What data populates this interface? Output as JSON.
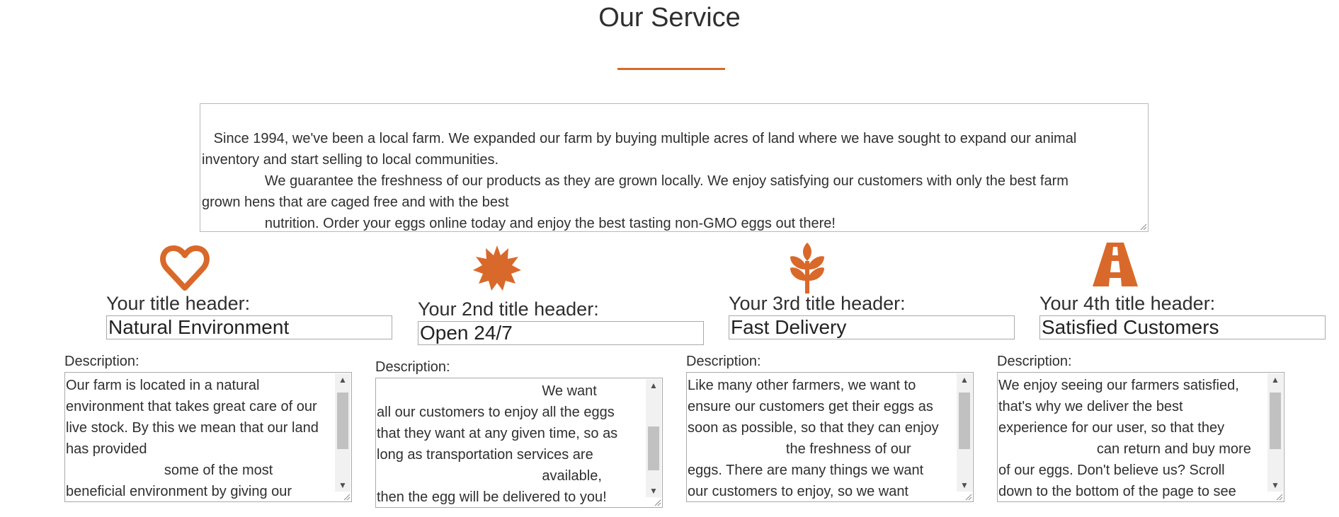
{
  "section": {
    "title": "Our Service",
    "accent_color": "#d9692a",
    "intro_text": " Since 1994, we've been a local farm. We expanded our farm by buying multiple acres of land where we have sought to expand our animal\ninventory and start selling to local communities.\n                We guarantee the freshness of our products as they are grown locally. We enjoy satisfying our customers with only the best farm\ngrown hens that are caged free and with the best\n                nutrition. Order your eggs online today and enjoy the best tasting non-GMO eggs out there!"
  },
  "services": [
    {
      "icon": "heart-icon",
      "label": "Your title header:",
      "title_value": "Natural Environment",
      "desc_label": "Description:",
      "description": "Our farm is located in a natural\nenvironment that takes great care of our\nlive stock. By this we mean that our land\nhas provided\n                         some of the most\nbeneficial environment by giving our"
    },
    {
      "icon": "sun-burst-icon",
      "label": "Your 2nd title header:",
      "title_value": "Open 24/7",
      "desc_label": "Description:",
      "description": "                                          We want\nall our customers to enjoy all the eggs\nthat they want at any given time, so as\nlong as transportation services are\n                                          available,\nthen the egg will be delivered to you!"
    },
    {
      "icon": "wheat-icon",
      "label": "Your 3rd title header:",
      "title_value": "Fast Delivery",
      "desc_label": "Description:",
      "description": "Like many other farmers, we want to\nensure our customers get their eggs as\nsoon as possible, so that they can enjoy\n                         the freshness of our\neggs. There are many things we want\nour customers to enjoy, so we want"
    },
    {
      "icon": "road-icon",
      "label": "Your 4th title header:",
      "title_value": "Satisfied Customers",
      "desc_label": "Description:",
      "description": "We enjoy seeing our farmers satisfied,\nthat's why we deliver the best\nexperience for our user, so that they\n                         can return and buy more\nof our eggs. Don't believe us? Scroll\ndown to the bottom of the page to see"
    }
  ]
}
